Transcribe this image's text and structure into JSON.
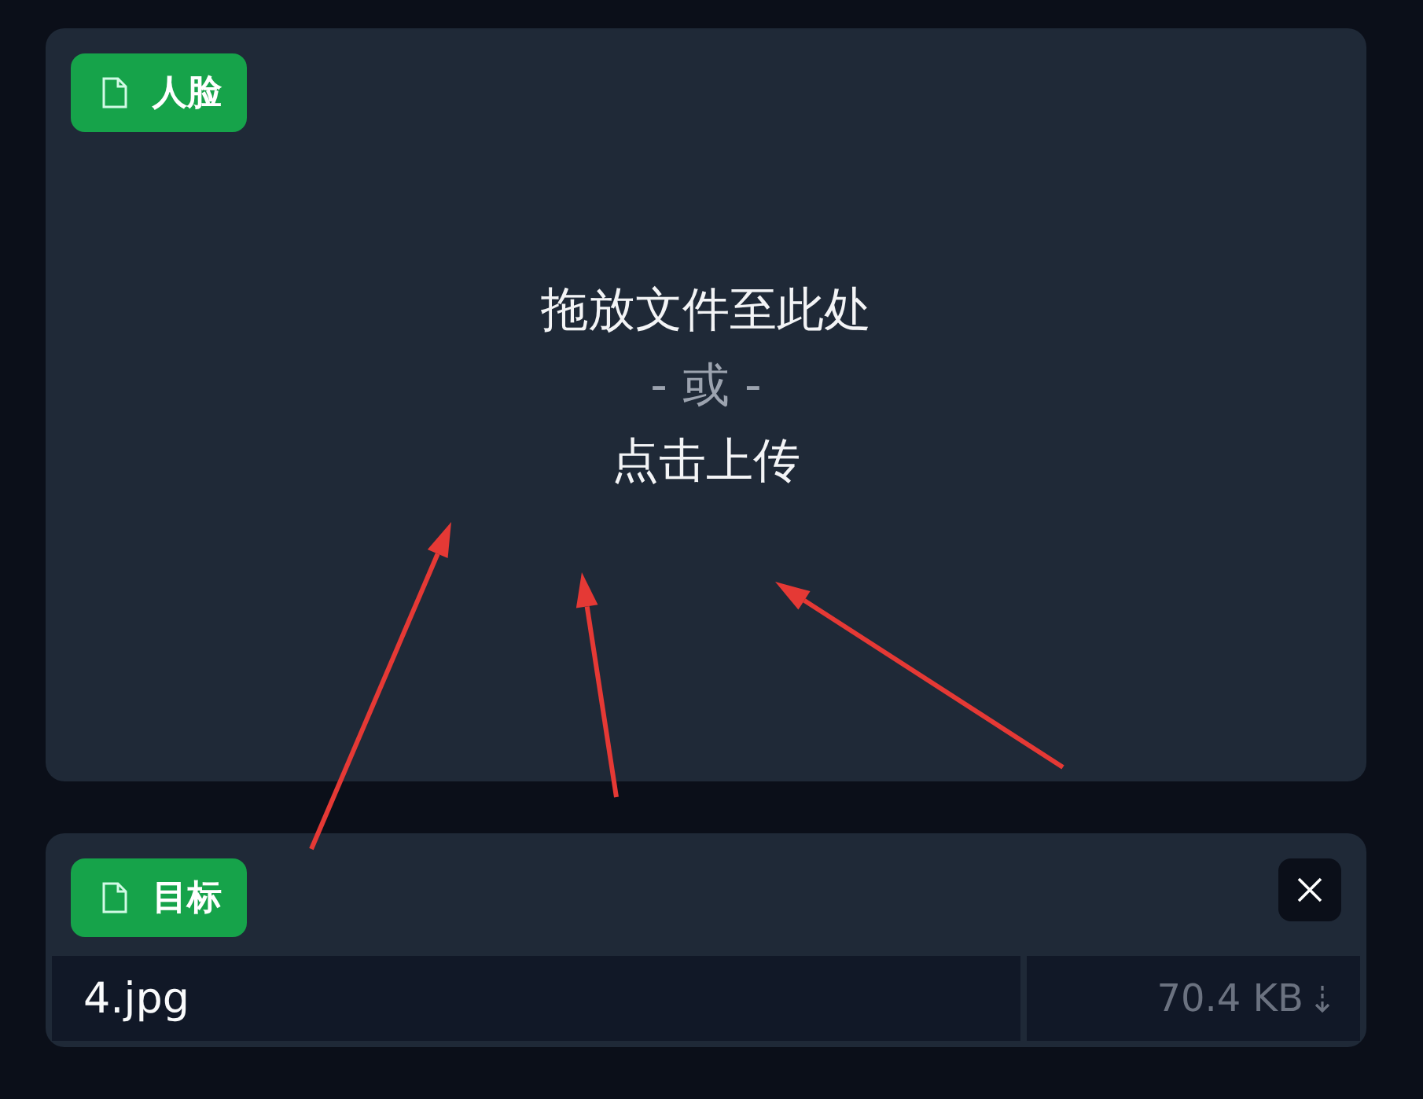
{
  "upload_panel": {
    "badge": "人脸",
    "drop_text": "拖放文件至此处",
    "or_text": "- 或 -",
    "click_text": "点击上传"
  },
  "file_panel": {
    "badge": "目标",
    "file_name": "4.jpg",
    "file_size": "70.4 KB"
  },
  "annotations": [
    {
      "kind": "arrow"
    },
    {
      "kind": "arrow"
    },
    {
      "kind": "arrow"
    }
  ]
}
